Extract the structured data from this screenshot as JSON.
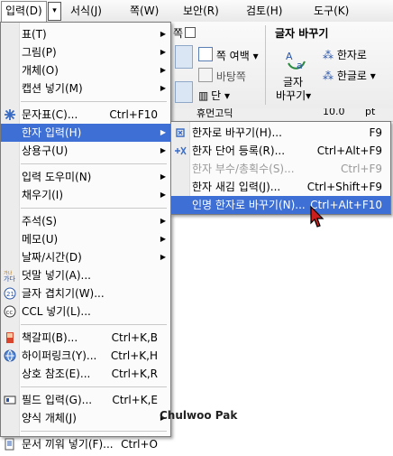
{
  "menubar": {
    "items": [
      {
        "label": "입력(D)",
        "active": true
      },
      {
        "label": "서식(J)"
      },
      {
        "label": "쪽(W)"
      },
      {
        "label": "보안(R)"
      },
      {
        "label": "검토(H)"
      },
      {
        "label": "도구(K)"
      }
    ],
    "dropdown_glyph": "▾"
  },
  "ribbon": {
    "page_label": "쪽",
    "page_margin": "쪽 여백",
    "background_page": "바탕쪽",
    "columns": "단",
    "group_title": "글자 바꾸기",
    "to_hanja": "한자로",
    "to_hangul": "한글로",
    "char_change": "글자",
    "char_change2": "바꾸기",
    "font_name": "휴먼고딕",
    "font_size": "10.0",
    "font_unit": "pt"
  },
  "menu": {
    "items": [
      {
        "label": "표(T)",
        "arrow": true
      },
      {
        "label": "그림(P)",
        "arrow": true
      },
      {
        "label": "개체(O)",
        "arrow": true
      },
      {
        "label": "캡션 넣기(M)",
        "arrow": true
      },
      {
        "sep": true
      },
      {
        "label": "문자표(C)...",
        "shortcut": "Ctrl+F10",
        "icon": "symbol-icon"
      },
      {
        "label": "한자 입력(H)",
        "arrow": true,
        "highlight": true
      },
      {
        "label": "상용구(U)",
        "arrow": true
      },
      {
        "sep": true
      },
      {
        "label": "입력 도우미(N)",
        "arrow": true
      },
      {
        "label": "채우기(I)",
        "arrow": true
      },
      {
        "sep": true
      },
      {
        "label": "주석(S)",
        "arrow": true
      },
      {
        "label": "메모(U)",
        "arrow": true
      },
      {
        "label": "날짜/시간(D)",
        "arrow": true
      },
      {
        "label": "덧말 넣기(A)...",
        "icon": "ruby-text-icon"
      },
      {
        "label": "글자 겹치기(W)...",
        "icon": "overlap-char-icon"
      },
      {
        "label": "CCL 넣기(L)...",
        "icon": "ccl-icon"
      },
      {
        "sep": true
      },
      {
        "label": "책갈피(B)...",
        "shortcut": "Ctrl+K,B",
        "icon": "bookmark-icon"
      },
      {
        "label": "하이퍼링크(Y)...",
        "shortcut": "Ctrl+K,H",
        "icon": "hyperlink-icon"
      },
      {
        "label": "상호 참조(E)...",
        "shortcut": "Ctrl+K,R"
      },
      {
        "sep": true
      },
      {
        "label": "필드 입력(G)...",
        "shortcut": "Ctrl+K,E",
        "icon": "field-icon"
      },
      {
        "label": "양식 개체(J)",
        "arrow": true
      },
      {
        "sep": true
      },
      {
        "label": "문서 끼워 넣기(F)...",
        "shortcut": "Ctrl+O",
        "icon": "insert-doc-icon"
      }
    ]
  },
  "submenu": {
    "items": [
      {
        "label": "한자로 바꾸기(H)...",
        "shortcut": "F9",
        "icon": "hanja-convert-icon"
      },
      {
        "label": "한자 단어 등록(R)...",
        "shortcut": "Ctrl+Alt+F9",
        "icon": "hanja-register-icon"
      },
      {
        "label": "한자 부수/총획수(S)...",
        "shortcut": "Ctrl+F9",
        "disabled": true
      },
      {
        "label": "한자 새김 입력(J)...",
        "shortcut": "Ctrl+Shift+F9"
      },
      {
        "label": "인명 한자로 바꾸기(N)...",
        "shortcut": "Ctrl+Alt+F10",
        "highlight": true
      }
    ]
  },
  "watermark": "Chulwoo Pak",
  "colors": {
    "highlight": "#3d6fd4",
    "disabled": "#9a9a9a"
  }
}
